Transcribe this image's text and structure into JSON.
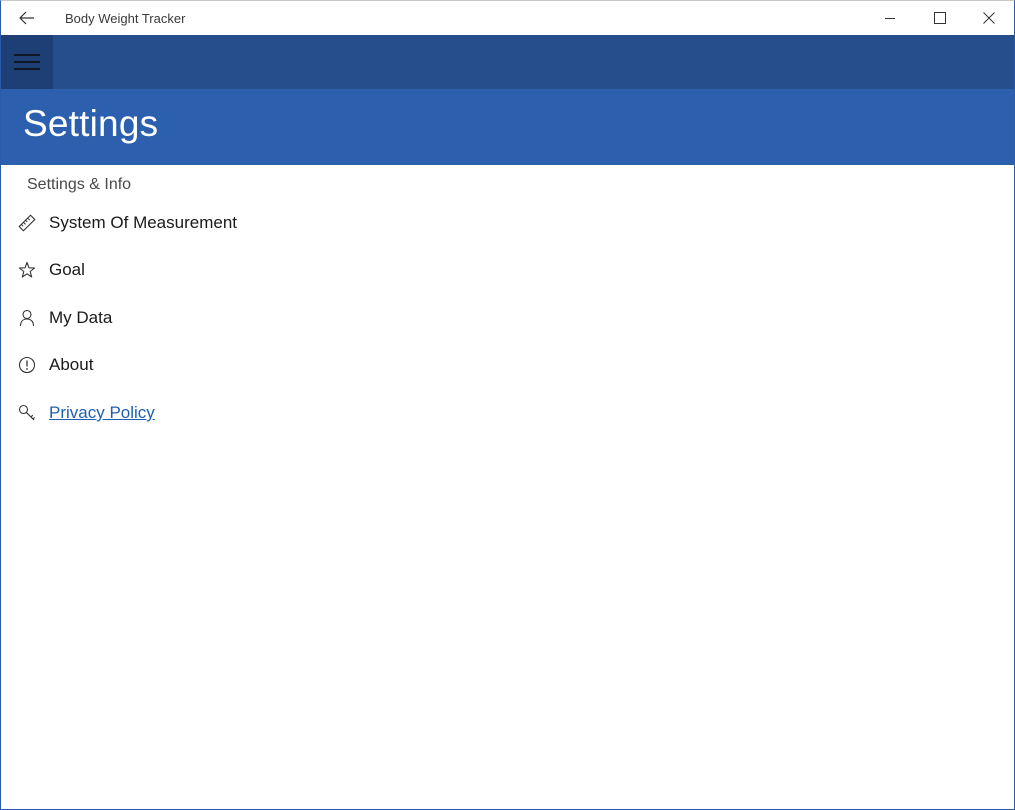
{
  "window": {
    "title": "Body Weight Tracker",
    "icons": {
      "back": "back-arrow-icon",
      "minimize": "minimize-icon",
      "maximize": "maximize-icon",
      "close": "close-icon"
    }
  },
  "commandbar": {
    "menu_icon": "hamburger-icon"
  },
  "header": {
    "title": "Settings"
  },
  "section": {
    "title": "Settings & Info"
  },
  "menu": {
    "items": [
      {
        "label": "System Of Measurement",
        "icon": "ruler-icon"
      },
      {
        "label": "Goal",
        "icon": "star-icon"
      },
      {
        "label": "My Data",
        "icon": "person-icon"
      },
      {
        "label": "About",
        "icon": "info-icon"
      },
      {
        "label": "Privacy Policy",
        "icon": "key-icon",
        "is_link": true
      }
    ]
  },
  "colors": {
    "cmdbar": "#264d8c",
    "hamburger_bg": "#1e3f75",
    "header": "#2c5fad",
    "link": "#1f5fb0"
  }
}
